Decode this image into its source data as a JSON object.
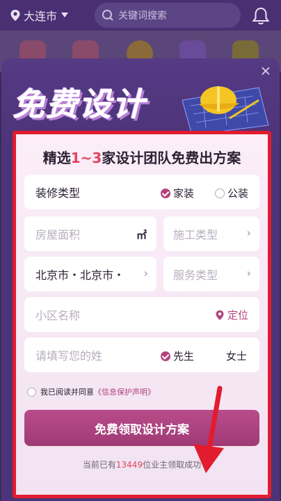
{
  "topbar": {
    "city": "大连市",
    "search_placeholder": "关键词搜索"
  },
  "modal": {
    "banner_title": "免费设计",
    "headline_pre": "精选",
    "headline_highlight": "1~3",
    "headline_post": "家设计团队免费出方案",
    "decor_type": {
      "label": "装修类型",
      "options": [
        "家装",
        "公装"
      ],
      "selected": "家装"
    },
    "area": {
      "placeholder": "房屋面积",
      "unit": "㎡"
    },
    "construction": {
      "placeholder": "施工类型",
      "chevron": "›"
    },
    "location": {
      "value": "北京市・北京市・",
      "chevron": "›"
    },
    "service": {
      "placeholder": "服务类型",
      "chevron": "›"
    },
    "community": {
      "placeholder": "小区名称",
      "locate_label": "定位"
    },
    "surname": {
      "placeholder": "请填写您的姓",
      "options": [
        "先生",
        "女士"
      ],
      "selected": "先生"
    },
    "agreement": {
      "text": "我已阅读并同意",
      "link": "《信息保护声明》"
    },
    "cta_label": "免费领取设计方案",
    "count_pre": "当前已有",
    "count_num": "13449",
    "count_post": "位业主领取成功"
  },
  "colors": {
    "accent": "#b3437e",
    "highlight": "#e0455e",
    "annotation_red": "#e21b2e",
    "modal_bg": "#4d3478"
  },
  "icons": [
    "location-pin-icon",
    "dropdown-triangle-icon",
    "search-icon",
    "bell-icon",
    "close-icon",
    "locate-icon",
    "checkmark-icon",
    "chevron-right-icon",
    "red-arrow-annotation"
  ]
}
